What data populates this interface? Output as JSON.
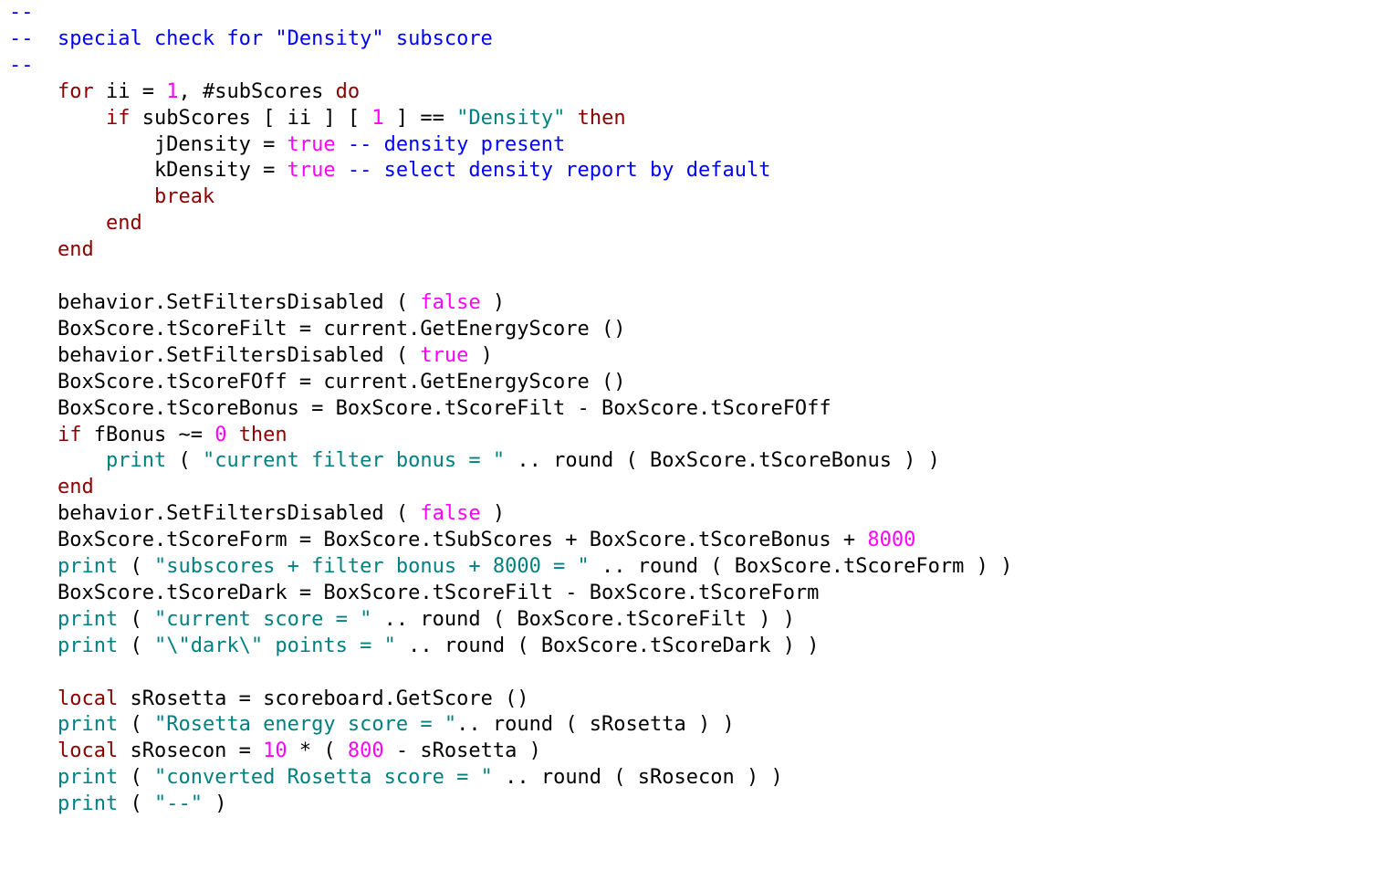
{
  "code": {
    "lines": [
      [
        {
          "t": "--",
          "c": "comment"
        }
      ],
      [
        {
          "t": "--  special check for \"Density\" subscore",
          "c": "comment"
        }
      ],
      [
        {
          "t": "--",
          "c": "comment"
        }
      ],
      [
        {
          "t": "    ",
          "c": "plain"
        },
        {
          "t": "for",
          "c": "keyword"
        },
        {
          "t": " ii = ",
          "c": "plain"
        },
        {
          "t": "1",
          "c": "number"
        },
        {
          "t": ", #subScores ",
          "c": "plain"
        },
        {
          "t": "do",
          "c": "keyword"
        }
      ],
      [
        {
          "t": "        ",
          "c": "plain"
        },
        {
          "t": "if",
          "c": "keyword"
        },
        {
          "t": " subScores [ ii ] [ ",
          "c": "plain"
        },
        {
          "t": "1",
          "c": "number"
        },
        {
          "t": " ] == ",
          "c": "plain"
        },
        {
          "t": "\"Density\"",
          "c": "string"
        },
        {
          "t": " ",
          "c": "plain"
        },
        {
          "t": "then",
          "c": "keyword"
        }
      ],
      [
        {
          "t": "            jDensity = ",
          "c": "plain"
        },
        {
          "t": "true",
          "c": "literal"
        },
        {
          "t": " ",
          "c": "plain"
        },
        {
          "t": "-- density present",
          "c": "comment"
        }
      ],
      [
        {
          "t": "            kDensity = ",
          "c": "plain"
        },
        {
          "t": "true",
          "c": "literal"
        },
        {
          "t": " ",
          "c": "plain"
        },
        {
          "t": "-- select density report by default",
          "c": "comment"
        }
      ],
      [
        {
          "t": "            ",
          "c": "plain"
        },
        {
          "t": "break",
          "c": "keyword"
        }
      ],
      [
        {
          "t": "        ",
          "c": "plain"
        },
        {
          "t": "end",
          "c": "keyword"
        }
      ],
      [
        {
          "t": "    ",
          "c": "plain"
        },
        {
          "t": "end",
          "c": "keyword"
        }
      ],
      [
        {
          "t": "",
          "c": "plain"
        }
      ],
      [
        {
          "t": "    behavior.SetFiltersDisabled ( ",
          "c": "plain"
        },
        {
          "t": "false",
          "c": "literal"
        },
        {
          "t": " )",
          "c": "plain"
        }
      ],
      [
        {
          "t": "    BoxScore.tScoreFilt = current.GetEnergyScore ()",
          "c": "plain"
        }
      ],
      [
        {
          "t": "    behavior.SetFiltersDisabled ( ",
          "c": "plain"
        },
        {
          "t": "true",
          "c": "literal"
        },
        {
          "t": " )",
          "c": "plain"
        }
      ],
      [
        {
          "t": "    BoxScore.tScoreFOff = current.GetEnergyScore ()",
          "c": "plain"
        }
      ],
      [
        {
          "t": "    BoxScore.tScoreBonus = BoxScore.tScoreFilt - BoxScore.tScoreFOff",
          "c": "plain"
        }
      ],
      [
        {
          "t": "    ",
          "c": "plain"
        },
        {
          "t": "if",
          "c": "keyword"
        },
        {
          "t": " fBonus ~= ",
          "c": "plain"
        },
        {
          "t": "0",
          "c": "number"
        },
        {
          "t": " ",
          "c": "plain"
        },
        {
          "t": "then",
          "c": "keyword"
        }
      ],
      [
        {
          "t": "        ",
          "c": "plain"
        },
        {
          "t": "print",
          "c": "string"
        },
        {
          "t": " ( ",
          "c": "plain"
        },
        {
          "t": "\"current filter bonus = \"",
          "c": "string"
        },
        {
          "t": " .. round ( BoxScore.tScoreBonus ) )",
          "c": "plain"
        }
      ],
      [
        {
          "t": "    ",
          "c": "plain"
        },
        {
          "t": "end",
          "c": "keyword"
        }
      ],
      [
        {
          "t": "    behavior.SetFiltersDisabled ( ",
          "c": "plain"
        },
        {
          "t": "false",
          "c": "literal"
        },
        {
          "t": " )",
          "c": "plain"
        }
      ],
      [
        {
          "t": "    BoxScore.tScoreForm = BoxScore.tSubScores + BoxScore.tScoreBonus + ",
          "c": "plain"
        },
        {
          "t": "8000",
          "c": "number"
        }
      ],
      [
        {
          "t": "    ",
          "c": "plain"
        },
        {
          "t": "print",
          "c": "string"
        },
        {
          "t": " ( ",
          "c": "plain"
        },
        {
          "t": "\"subscores + filter bonus + 8000 = \"",
          "c": "string"
        },
        {
          "t": " .. round ( BoxScore.tScoreForm ) )",
          "c": "plain"
        }
      ],
      [
        {
          "t": "    BoxScore.tScoreDark = BoxScore.tScoreFilt - BoxScore.tScoreForm",
          "c": "plain"
        }
      ],
      [
        {
          "t": "    ",
          "c": "plain"
        },
        {
          "t": "print",
          "c": "string"
        },
        {
          "t": " ( ",
          "c": "plain"
        },
        {
          "t": "\"current score = \"",
          "c": "string"
        },
        {
          "t": " .. round ( BoxScore.tScoreFilt ) )",
          "c": "plain"
        }
      ],
      [
        {
          "t": "    ",
          "c": "plain"
        },
        {
          "t": "print",
          "c": "string"
        },
        {
          "t": " ( ",
          "c": "plain"
        },
        {
          "t": "\"\\\"dark\\\" points = \"",
          "c": "string"
        },
        {
          "t": " .. round ( BoxScore.tScoreDark ) )",
          "c": "plain"
        }
      ],
      [
        {
          "t": "",
          "c": "plain"
        }
      ],
      [
        {
          "t": "    ",
          "c": "plain"
        },
        {
          "t": "local",
          "c": "keyword"
        },
        {
          "t": " sRosetta = scoreboard.GetScore ()",
          "c": "plain"
        }
      ],
      [
        {
          "t": "    ",
          "c": "plain"
        },
        {
          "t": "print",
          "c": "string"
        },
        {
          "t": " ( ",
          "c": "plain"
        },
        {
          "t": "\"Rosetta energy score = \"",
          "c": "string"
        },
        {
          "t": ".. round ( sRosetta ) )",
          "c": "plain"
        }
      ],
      [
        {
          "t": "    ",
          "c": "plain"
        },
        {
          "t": "local",
          "c": "keyword"
        },
        {
          "t": " sRosecon = ",
          "c": "plain"
        },
        {
          "t": "10",
          "c": "number"
        },
        {
          "t": " * ( ",
          "c": "plain"
        },
        {
          "t": "800",
          "c": "number"
        },
        {
          "t": " - sRosetta )",
          "c": "plain"
        }
      ],
      [
        {
          "t": "    ",
          "c": "plain"
        },
        {
          "t": "print",
          "c": "string"
        },
        {
          "t": " ( ",
          "c": "plain"
        },
        {
          "t": "\"converted Rosetta score = \"",
          "c": "string"
        },
        {
          "t": " .. round ( sRosecon ) )",
          "c": "plain"
        }
      ],
      [
        {
          "t": "    ",
          "c": "plain"
        },
        {
          "t": "print",
          "c": "string"
        },
        {
          "t": " ( ",
          "c": "plain"
        },
        {
          "t": "\"--\"",
          "c": "string"
        },
        {
          "t": " )",
          "c": "plain"
        }
      ]
    ]
  }
}
